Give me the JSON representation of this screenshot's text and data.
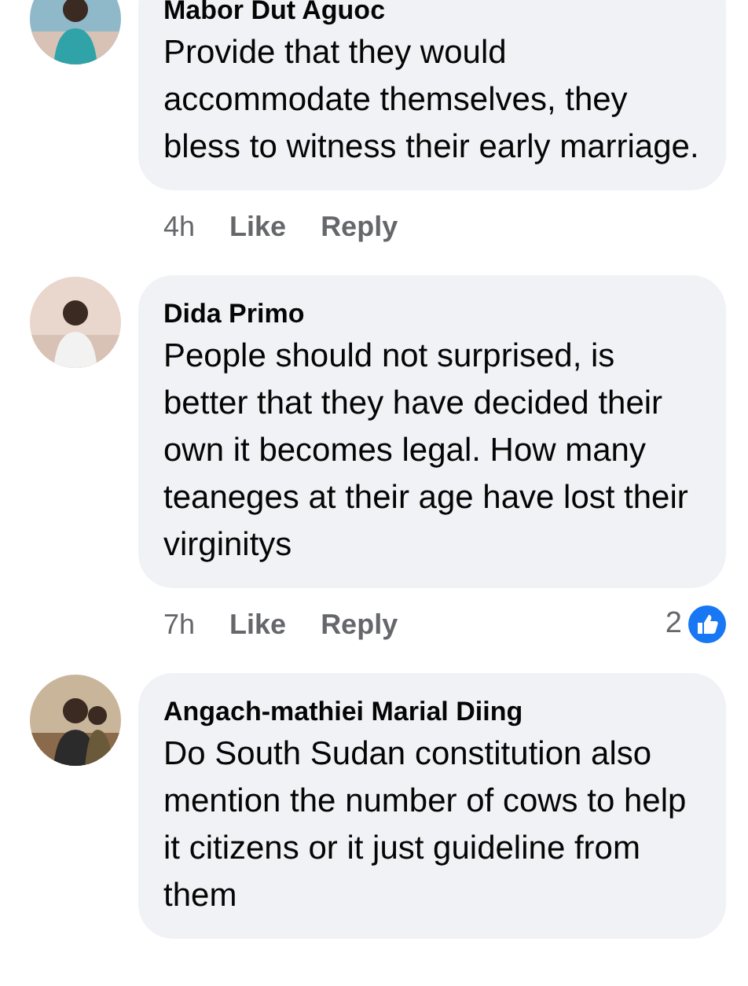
{
  "comments": [
    {
      "author": "Mabor Dut Aguoc",
      "text": "Provide that they would accommodate themselves, they bless to witness their early marriage.",
      "time": "4h",
      "like": "Like",
      "reply": "Reply"
    },
    {
      "author": "Dida Primo",
      "text": "People should not surprised, is better that they have decided their own it becomes legal. How many teaneges at their age have lost their virginitys",
      "time": "7h",
      "like": "Like",
      "reply": "Reply",
      "reaction_count": "2"
    },
    {
      "author": "Angach-mathiei Marial Diing",
      "text": "Do South Sudan constitution also mention the number of cows to help it citizens or it just guideline from them"
    }
  ]
}
